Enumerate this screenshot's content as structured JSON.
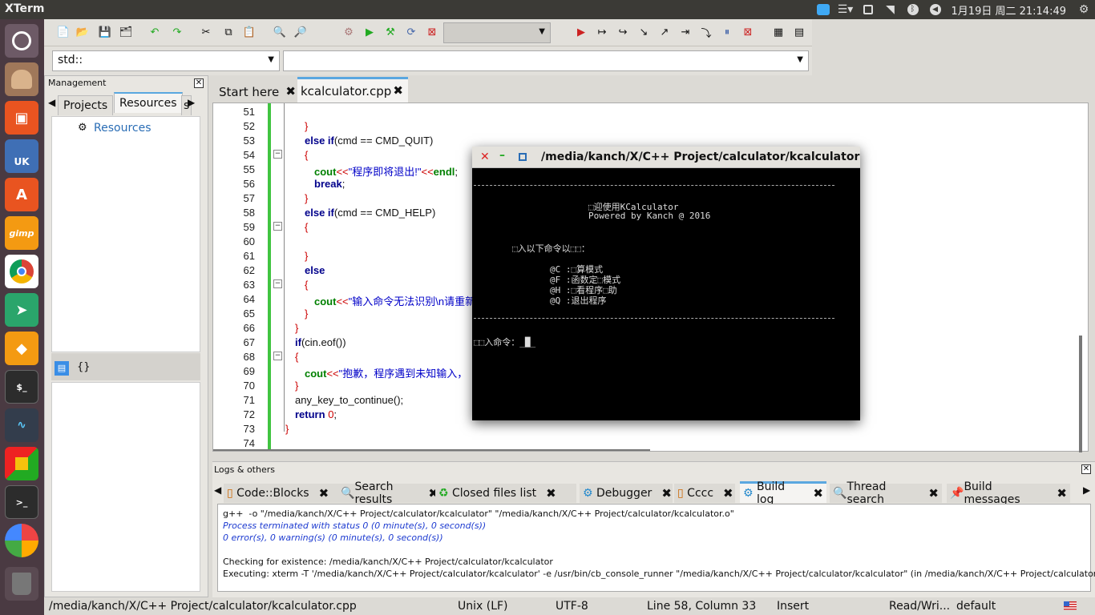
{
  "topbar": {
    "app_title": "XTerm",
    "clock": "1月19日 周二 21:14:49"
  },
  "launcher": {
    "items": [
      "ubuntu-logo-icon",
      "files-icon",
      "software-center-icon",
      "uk-icon",
      "app-store-icon",
      "gimp-icon",
      "chrome-icon",
      "telegram-icon",
      "settings-icon",
      "terminal-icon",
      "audio-icon",
      "cube-icon",
      "terminal2-icon",
      "photos-icon",
      "trash-icon"
    ],
    "uk_label": "UK"
  },
  "toolbar2": {
    "scope_value": "std::",
    "function_value": ""
  },
  "management": {
    "title": "Management",
    "tabs": [
      "Projects",
      "Resources",
      "s"
    ],
    "tree_item": "Resources",
    "symbol_label": "{}"
  },
  "editor": {
    "tabs": [
      {
        "label": "Start here"
      },
      {
        "label": "kcalculator.cpp"
      }
    ],
    "line_numbers": [
      "51",
      "52",
      "53",
      "54",
      "55",
      "56",
      "57",
      "58",
      "59",
      "60",
      "61",
      "62",
      "63",
      "64",
      "65",
      "66",
      "67",
      "68",
      "69",
      "70",
      "71",
      "72",
      "73",
      "74"
    ]
  },
  "code": {
    "l52": "}",
    "l53_kw": "else if",
    "l53_rest": "(cmd == CMD_QUIT)",
    "l54": "{",
    "l55_cout": "cout",
    "l55_op": "<<",
    "l55_str": "\"程序即将退出!\"",
    "l55_op2": "<<",
    "l55_endl": "endl",
    "l55_end": ";",
    "l56_kw": "break",
    "l56_end": ";",
    "l57": "}",
    "l58_kw": "else if",
    "l58_rest": "(cmd == CMD_HELP)",
    "l59": "{",
    "l61": "}",
    "l62_kw": "else",
    "l63": "{",
    "l64_cout": "cout",
    "l64_op": "<<",
    "l64_str": "\"输入命令无法识别\\n请重新",
    "l65": "}",
    "l66": "}",
    "l67_kw": "if",
    "l67_rest": "(cin.eof())",
    "l68": "{",
    "l69_cout": "cout",
    "l69_op": "<<",
    "l69_str": "\"抱歉，程序遇到未知输入，",
    "l70": "}",
    "l71": "any_key_to_continue();",
    "l72_kw": "return",
    "l72_val": "0",
    "l72_end": ";",
    "l73": "}"
  },
  "xterm": {
    "title": "/media/kanch/X/C++ Project/calculator/kcalculator",
    "lines": {
      "welcome": "⬚迎使用KCalculator",
      "powered": "Powered by Kanch @ 2016",
      "input_prompt": "⬚入以下命令以⬚⬚：",
      "cmd_c": "@C :⬚算模式",
      "cmd_f": "@F :函数定⬚模式",
      "cmd_h": "@H :⬚看程序⬚助",
      "cmd_q": "@Q :退出程序",
      "enter": "⬚⬚入命令：_█_"
    }
  },
  "logs": {
    "title": "Logs & others",
    "tabs": [
      {
        "label": "Code::Blocks"
      },
      {
        "label": "Search results"
      },
      {
        "label": "Closed files list"
      },
      {
        "label": "Debugger"
      },
      {
        "label": "Cccc"
      },
      {
        "label": "Build log"
      },
      {
        "label": "Thread search"
      },
      {
        "label": "Build messages"
      }
    ],
    "lines": [
      "g++  -o \"/media/kanch/X/C++ Project/calculator/kcalculator\" \"/media/kanch/X/C++ Project/calculator/kcalculator.o\"",
      "Process terminated with status 0 (0 minute(s), 0 second(s))",
      "0 error(s), 0 warning(s) (0 minute(s), 0 second(s))",
      "",
      "Checking for existence: /media/kanch/X/C++ Project/calculator/kcalculator",
      "Executing: xterm -T '/media/kanch/X/C++ Project/calculator/kcalculator' -e /usr/bin/cb_console_runner \"/media/kanch/X/C++ Project/calculator/kcalculator\" (in /media/kanch/X/C++ Project/calculator)"
    ]
  },
  "status": {
    "file": "/media/kanch/X/C++ Project/calculator/kcalculator.cpp",
    "eol": "Unix (LF)",
    "encoding": "UTF-8",
    "position": "Line 58, Column 33",
    "mode": "Insert",
    "access": "Read/Wri...",
    "profile": "default"
  }
}
